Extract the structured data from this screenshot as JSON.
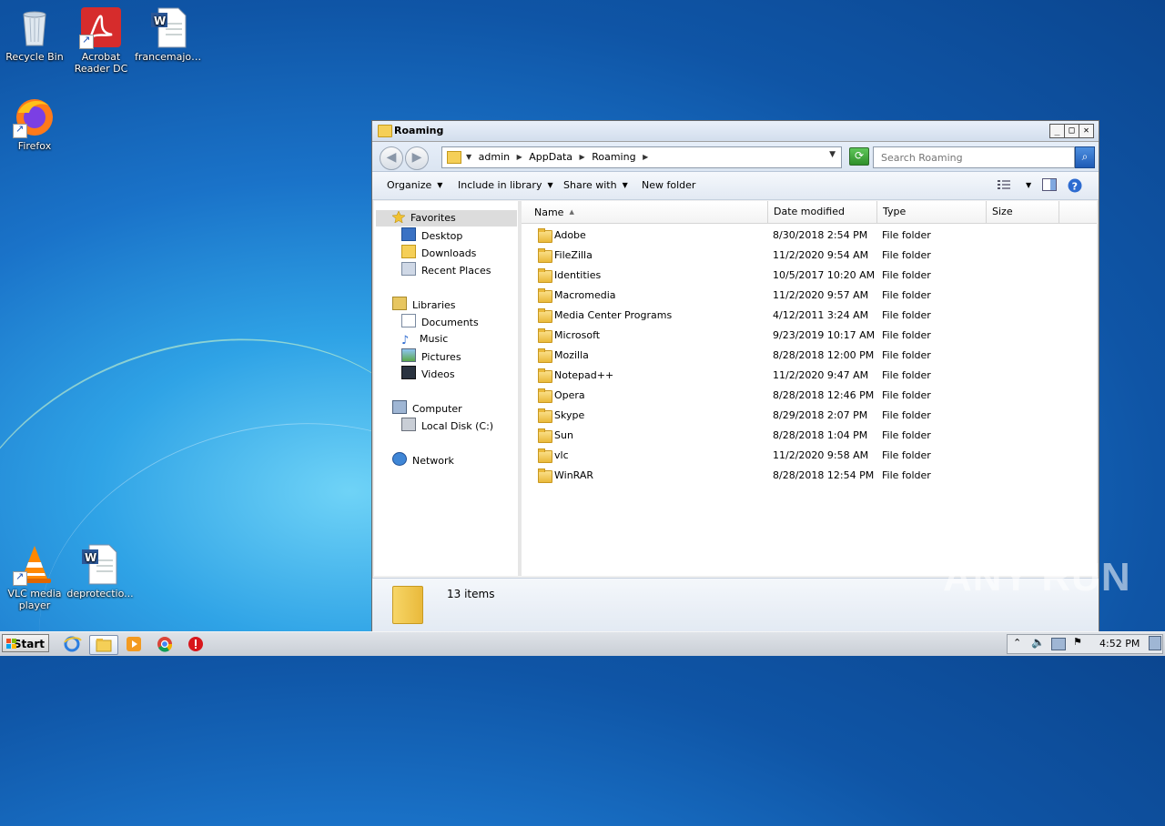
{
  "desktop": {
    "icons": [
      {
        "label": "Recycle Bin"
      },
      {
        "label": "Acrobat Reader DC"
      },
      {
        "label": "francemajor..."
      },
      {
        "label": "Firefox"
      },
      {
        "label": "VLC media player"
      },
      {
        "label": "deprotectio..."
      }
    ]
  },
  "window": {
    "title": "Roaming",
    "minimize": "_",
    "maximize": "□",
    "close": "✕",
    "breadcrumbs": [
      "admin",
      "AppData",
      "Roaming"
    ],
    "search_placeholder": "Search Roaming",
    "toolbar": {
      "organize": "Organize",
      "include_in_library": "Include in library",
      "share_with": "Share with",
      "new_folder": "New folder"
    },
    "nav": {
      "favorites": "Favorites",
      "desktop": "Desktop",
      "downloads": "Downloads",
      "recent_places": "Recent Places",
      "libraries": "Libraries",
      "documents": "Documents",
      "music": "Music",
      "pictures": "Pictures",
      "videos": "Videos",
      "computer": "Computer",
      "local_disk": "Local Disk (C:)",
      "network": "Network"
    },
    "columns": {
      "name": "Name",
      "date": "Date modified",
      "type": "Type",
      "size": "Size"
    },
    "files": [
      {
        "name": "Adobe",
        "date": "8/30/2018 2:54 PM",
        "type": "File folder"
      },
      {
        "name": "FileZilla",
        "date": "11/2/2020 9:54 AM",
        "type": "File folder"
      },
      {
        "name": "Identities",
        "date": "10/5/2017 10:20 AM",
        "type": "File folder"
      },
      {
        "name": "Macromedia",
        "date": "11/2/2020 9:57 AM",
        "type": "File folder"
      },
      {
        "name": "Media Center Programs",
        "date": "4/12/2011 3:24 AM",
        "type": "File folder"
      },
      {
        "name": "Microsoft",
        "date": "9/23/2019 10:17 AM",
        "type": "File folder"
      },
      {
        "name": "Mozilla",
        "date": "8/28/2018 12:00 PM",
        "type": "File folder"
      },
      {
        "name": "Notepad++",
        "date": "11/2/2020 9:47 AM",
        "type": "File folder"
      },
      {
        "name": "Opera",
        "date": "8/28/2018 12:46 PM",
        "type": "File folder"
      },
      {
        "name": "Skype",
        "date": "8/29/2018 2:07 PM",
        "type": "File folder"
      },
      {
        "name": "Sun",
        "date": "8/28/2018 1:04 PM",
        "type": "File folder"
      },
      {
        "name": "vlc",
        "date": "11/2/2020 9:58 AM",
        "type": "File folder"
      },
      {
        "name": "WinRAR",
        "date": "8/28/2018 12:54 PM",
        "type": "File folder"
      }
    ],
    "status": "13 items"
  },
  "taskbar": {
    "start": "Start",
    "clock": "4:52 PM"
  },
  "watermark": "ANY RUN",
  "icons": [
    "recycle-bin-icon",
    "acrobat-icon",
    "word-doc-icon",
    "firefox-icon",
    "vlc-icon",
    "folder-icon",
    "search-icon",
    "help-icon",
    "star-icon",
    "ie-icon",
    "chrome-icon",
    "media-player-icon"
  ]
}
